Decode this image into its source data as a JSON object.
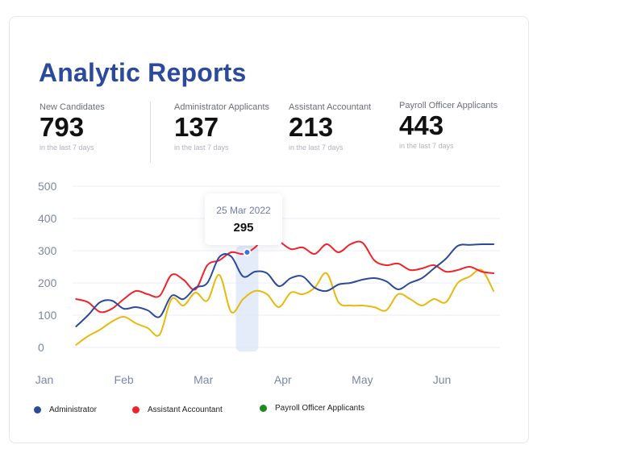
{
  "header": {
    "title": "Analytic Reports"
  },
  "stats": [
    {
      "label": "New Candidates",
      "value": "793",
      "sub": "in the last 7 days"
    },
    {
      "label": "Administrator Applicants",
      "value": "137",
      "sub": "in the last 7 days"
    },
    {
      "label": "Assistant Accountant",
      "value": "213",
      "sub": "in the last 7 days"
    },
    {
      "label": "Payroll Officer Applicants",
      "value": "443",
      "sub": "in the last 7 days"
    }
  ],
  "tooltip": {
    "date": "25 Mar 2022",
    "value": "295"
  },
  "legend": [
    {
      "name": "Administrator",
      "color": "#2b4a9c"
    },
    {
      "name": "Assistant Accountant",
      "color": "#f2222b"
    },
    {
      "name": "Payroll Officer Applicants",
      "color": "#1f8a1f"
    }
  ],
  "chart_data": {
    "type": "line",
    "title": "",
    "xlabel": "",
    "ylabel": "",
    "ylim": [
      0,
      500
    ],
    "yticks": [
      "0",
      "100",
      "200",
      "300",
      "400",
      "500"
    ],
    "xticks": [
      "Jan",
      "Feb",
      "Mar",
      "Apr",
      "May",
      "Jun"
    ],
    "grid": true,
    "x": [
      0.4,
      0.55,
      0.7,
      0.85,
      1.0,
      1.15,
      1.3,
      1.45,
      1.6,
      1.75,
      1.9,
      2.05,
      2.2,
      2.35,
      2.5,
      2.65,
      2.8,
      2.95,
      3.1,
      3.25,
      3.4,
      3.55,
      3.7,
      3.85,
      4.0,
      4.15,
      4.3,
      4.45,
      4.6,
      4.75,
      4.9,
      5.05,
      5.2,
      5.35,
      5.5,
      5.65
    ],
    "series": [
      {
        "name": "Administrator",
        "color": "#2b4a9c",
        "values": [
          65,
          100,
          140,
          145,
          120,
          125,
          115,
          95,
          160,
          150,
          185,
          200,
          280,
          282,
          220,
          235,
          230,
          190,
          215,
          220,
          185,
          175,
          195,
          200,
          210,
          215,
          205,
          180,
          200,
          215,
          245,
          275,
          315,
          318,
          320,
          320
        ]
      },
      {
        "name": "Assistant Accountant",
        "color": "#f2222b",
        "values": [
          150,
          140,
          110,
          120,
          150,
          175,
          165,
          160,
          225,
          210,
          180,
          255,
          270,
          295,
          290,
          310,
          350,
          330,
          305,
          310,
          290,
          320,
          295,
          320,
          325,
          270,
          255,
          260,
          240,
          245,
          255,
          235,
          240,
          250,
          235,
          230
        ]
      },
      {
        "name": "Payroll Officer Applicants",
        "color": "#e8b90f",
        "values": [
          8,
          35,
          55,
          80,
          95,
          75,
          60,
          40,
          150,
          130,
          170,
          145,
          225,
          110,
          150,
          175,
          165,
          125,
          170,
          165,
          185,
          230,
          140,
          130,
          130,
          125,
          115,
          165,
          150,
          130,
          150,
          140,
          200,
          220,
          240,
          175
        ]
      }
    ],
    "highlight": {
      "x": 2.55,
      "value": 295
    }
  }
}
